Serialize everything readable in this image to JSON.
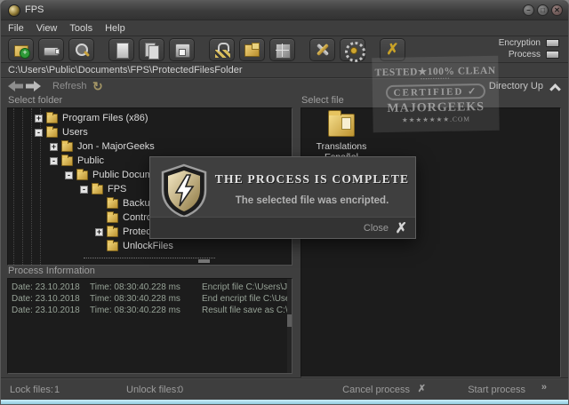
{
  "window": {
    "title": "FPS"
  },
  "menu": {
    "items": [
      "File",
      "View",
      "Tools",
      "Help"
    ]
  },
  "toolbar": {
    "buttons": [
      {
        "name": "add-folder",
        "icon": "folder-add",
        "group": 1
      },
      {
        "name": "usb-drive",
        "icon": "usb",
        "group": 1
      },
      {
        "name": "search-files",
        "icon": "search",
        "group": 1
      },
      {
        "name": "new-file",
        "icon": "page",
        "group": 2
      },
      {
        "name": "copy-files",
        "icon": "copy",
        "group": 2
      },
      {
        "name": "save-file",
        "icon": "floppy",
        "group": 2
      },
      {
        "name": "encrypt-case",
        "icon": "lock",
        "group": 3
      },
      {
        "name": "save-encrypted",
        "icon": "folder-key",
        "group": 3
      },
      {
        "name": "archive-box",
        "icon": "box",
        "group": 3
      },
      {
        "name": "tools",
        "icon": "tools",
        "group": 4
      },
      {
        "name": "settings",
        "icon": "gear",
        "group": 4
      },
      {
        "name": "exit",
        "icon": "exit",
        "group": 5
      }
    ],
    "encryption_label": "Encryption",
    "process_label": "Process"
  },
  "address": {
    "path": "C:\\Users\\Public\\Documents\\FPS\\ProtectedFilesFolder"
  },
  "nav": {
    "refresh_label": "Refresh",
    "refresh_glyph": "↻",
    "directory_up_label": "Directory Up"
  },
  "folder_panel": {
    "header": "Select folder",
    "tree": [
      {
        "label": "Program Files (x86)",
        "depth": 2,
        "expand": "+"
      },
      {
        "label": "Users",
        "depth": 2,
        "expand": "-"
      },
      {
        "label": "Jon - MajorGeeks",
        "depth": 3,
        "expand": "+"
      },
      {
        "label": "Public",
        "depth": 3,
        "expand": "-"
      },
      {
        "label": "Public Documents",
        "depth": 4,
        "expand": "-"
      },
      {
        "label": "FPS",
        "depth": 5,
        "expand": "-"
      },
      {
        "label": "BackupFile",
        "depth": 6,
        "expand": ""
      },
      {
        "label": "ControlFile",
        "depth": 6,
        "expand": ""
      },
      {
        "label": "ProtectedF",
        "depth": 6,
        "expand": "+"
      },
      {
        "label": "UnlockFiles",
        "depth": 6,
        "expand": ""
      }
    ]
  },
  "file_panel": {
    "header": "Select file",
    "items": [
      {
        "label_lines": [
          "Translations",
          "Español"
        ]
      }
    ]
  },
  "process_panel": {
    "header": "Process Information",
    "logs": [
      {
        "date": "Date: 23.10.2018",
        "time": "Time: 08:30:40.228 ms",
        "message": "Encript file C:\\Users\\Jon - MajorGe"
      },
      {
        "date": "Date: 23.10.2018",
        "time": "Time: 08:30:40.228 ms",
        "message": "End encript file C:\\Users\\Jon - Majo"
      },
      {
        "date": "Date: 23.10.2018",
        "time": "Time: 08:30:40.228 ms",
        "message": "Result file save as C:\\Users\\Public\\"
      }
    ]
  },
  "status_bar": {
    "lock_label": "Lock files:",
    "lock_value": "1",
    "unlock_label": "Unlock files:",
    "unlock_value": "0",
    "cancel_label": "Cancel process",
    "cancel_glyph": "✗",
    "start_label": "Start process",
    "start_glyph": "»"
  },
  "dialog": {
    "title": "THE PROCESS IS COMPLETE",
    "message": "The selected file was encripted.",
    "close_label": "Close",
    "close_glyph": "✗"
  },
  "watermark": {
    "line1": "TESTED★100% CLEAN",
    "line2": "▪▪▪▪▪▪▪▪▪▪▪▪",
    "line3": "CERTIFIED ✓",
    "line4": "MAJORGEEKS",
    "line5": "★★★★★★★.COM"
  },
  "colors": {
    "gold_accent": "#c9a227",
    "window_bg": "#3e3e3e",
    "content_bg": "#1c1c1c",
    "log_text": "#96a296",
    "aero_edge": "#8ecbe0"
  }
}
